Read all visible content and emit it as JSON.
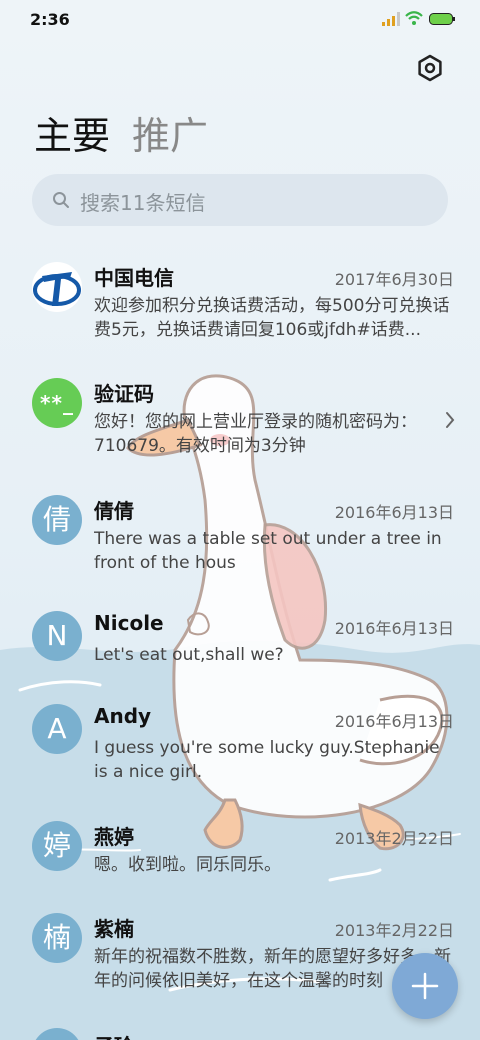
{
  "status": {
    "time": "2:36"
  },
  "header": {
    "settings_icon": "gear-icon",
    "tabs": [
      {
        "label": "主要"
      },
      {
        "label": "推广"
      }
    ]
  },
  "search": {
    "placeholder": "搜索11条短信"
  },
  "conversations": [
    {
      "avatar": "",
      "avatar_type": "logo",
      "name": "中国电信",
      "date": "2017年6月30日",
      "preview": "欢迎参加积分兑换话费活动，每500分可兑换话费5元，兑换话费请回复106或jfdh#话费..."
    },
    {
      "avatar": "**_",
      "avatar_type": "green",
      "name": "验证码",
      "date": "",
      "preview": "您好！您的网上营业厅登录的随机密码为：710679。有效时间为3分钟"
    },
    {
      "avatar": "倩",
      "avatar_type": "letter",
      "name": "倩倩",
      "date": "2016年6月13日",
      "preview": "There was a table set out under a tree in front of the hous"
    },
    {
      "avatar": "N",
      "avatar_type": "letter",
      "name": "Nicole",
      "date": "2016年6月13日",
      "preview": "Let's eat out,shall we?"
    },
    {
      "avatar": "A",
      "avatar_type": "letter",
      "name": "Andy",
      "date": "2016年6月13日",
      "preview": "I guess you're some lucky guy.Stephanie is a nice girl."
    },
    {
      "avatar": "婷",
      "avatar_type": "letter",
      "name": "燕婷",
      "date": "2013年2月22日",
      "preview": "嗯。收到啦。同乐同乐。"
    },
    {
      "avatar": "楠",
      "avatar_type": "letter",
      "name": "紫楠",
      "date": "2013年2月22日",
      "preview": "新年的祝福数不胜数，新年的愿望好多好多，新年的问候依旧美好，在这个温馨的时刻"
    },
    {
      "avatar": "",
      "avatar_type": "letter",
      "name": "子玲",
      "date": "",
      "preview": ""
    }
  ],
  "fab": {
    "icon": "plus-icon"
  },
  "colors": {
    "avatar": "#7ab0cf",
    "verify_green": "#66cc55",
    "fab": "#7fa9d6",
    "background": "#e7f0f6"
  }
}
